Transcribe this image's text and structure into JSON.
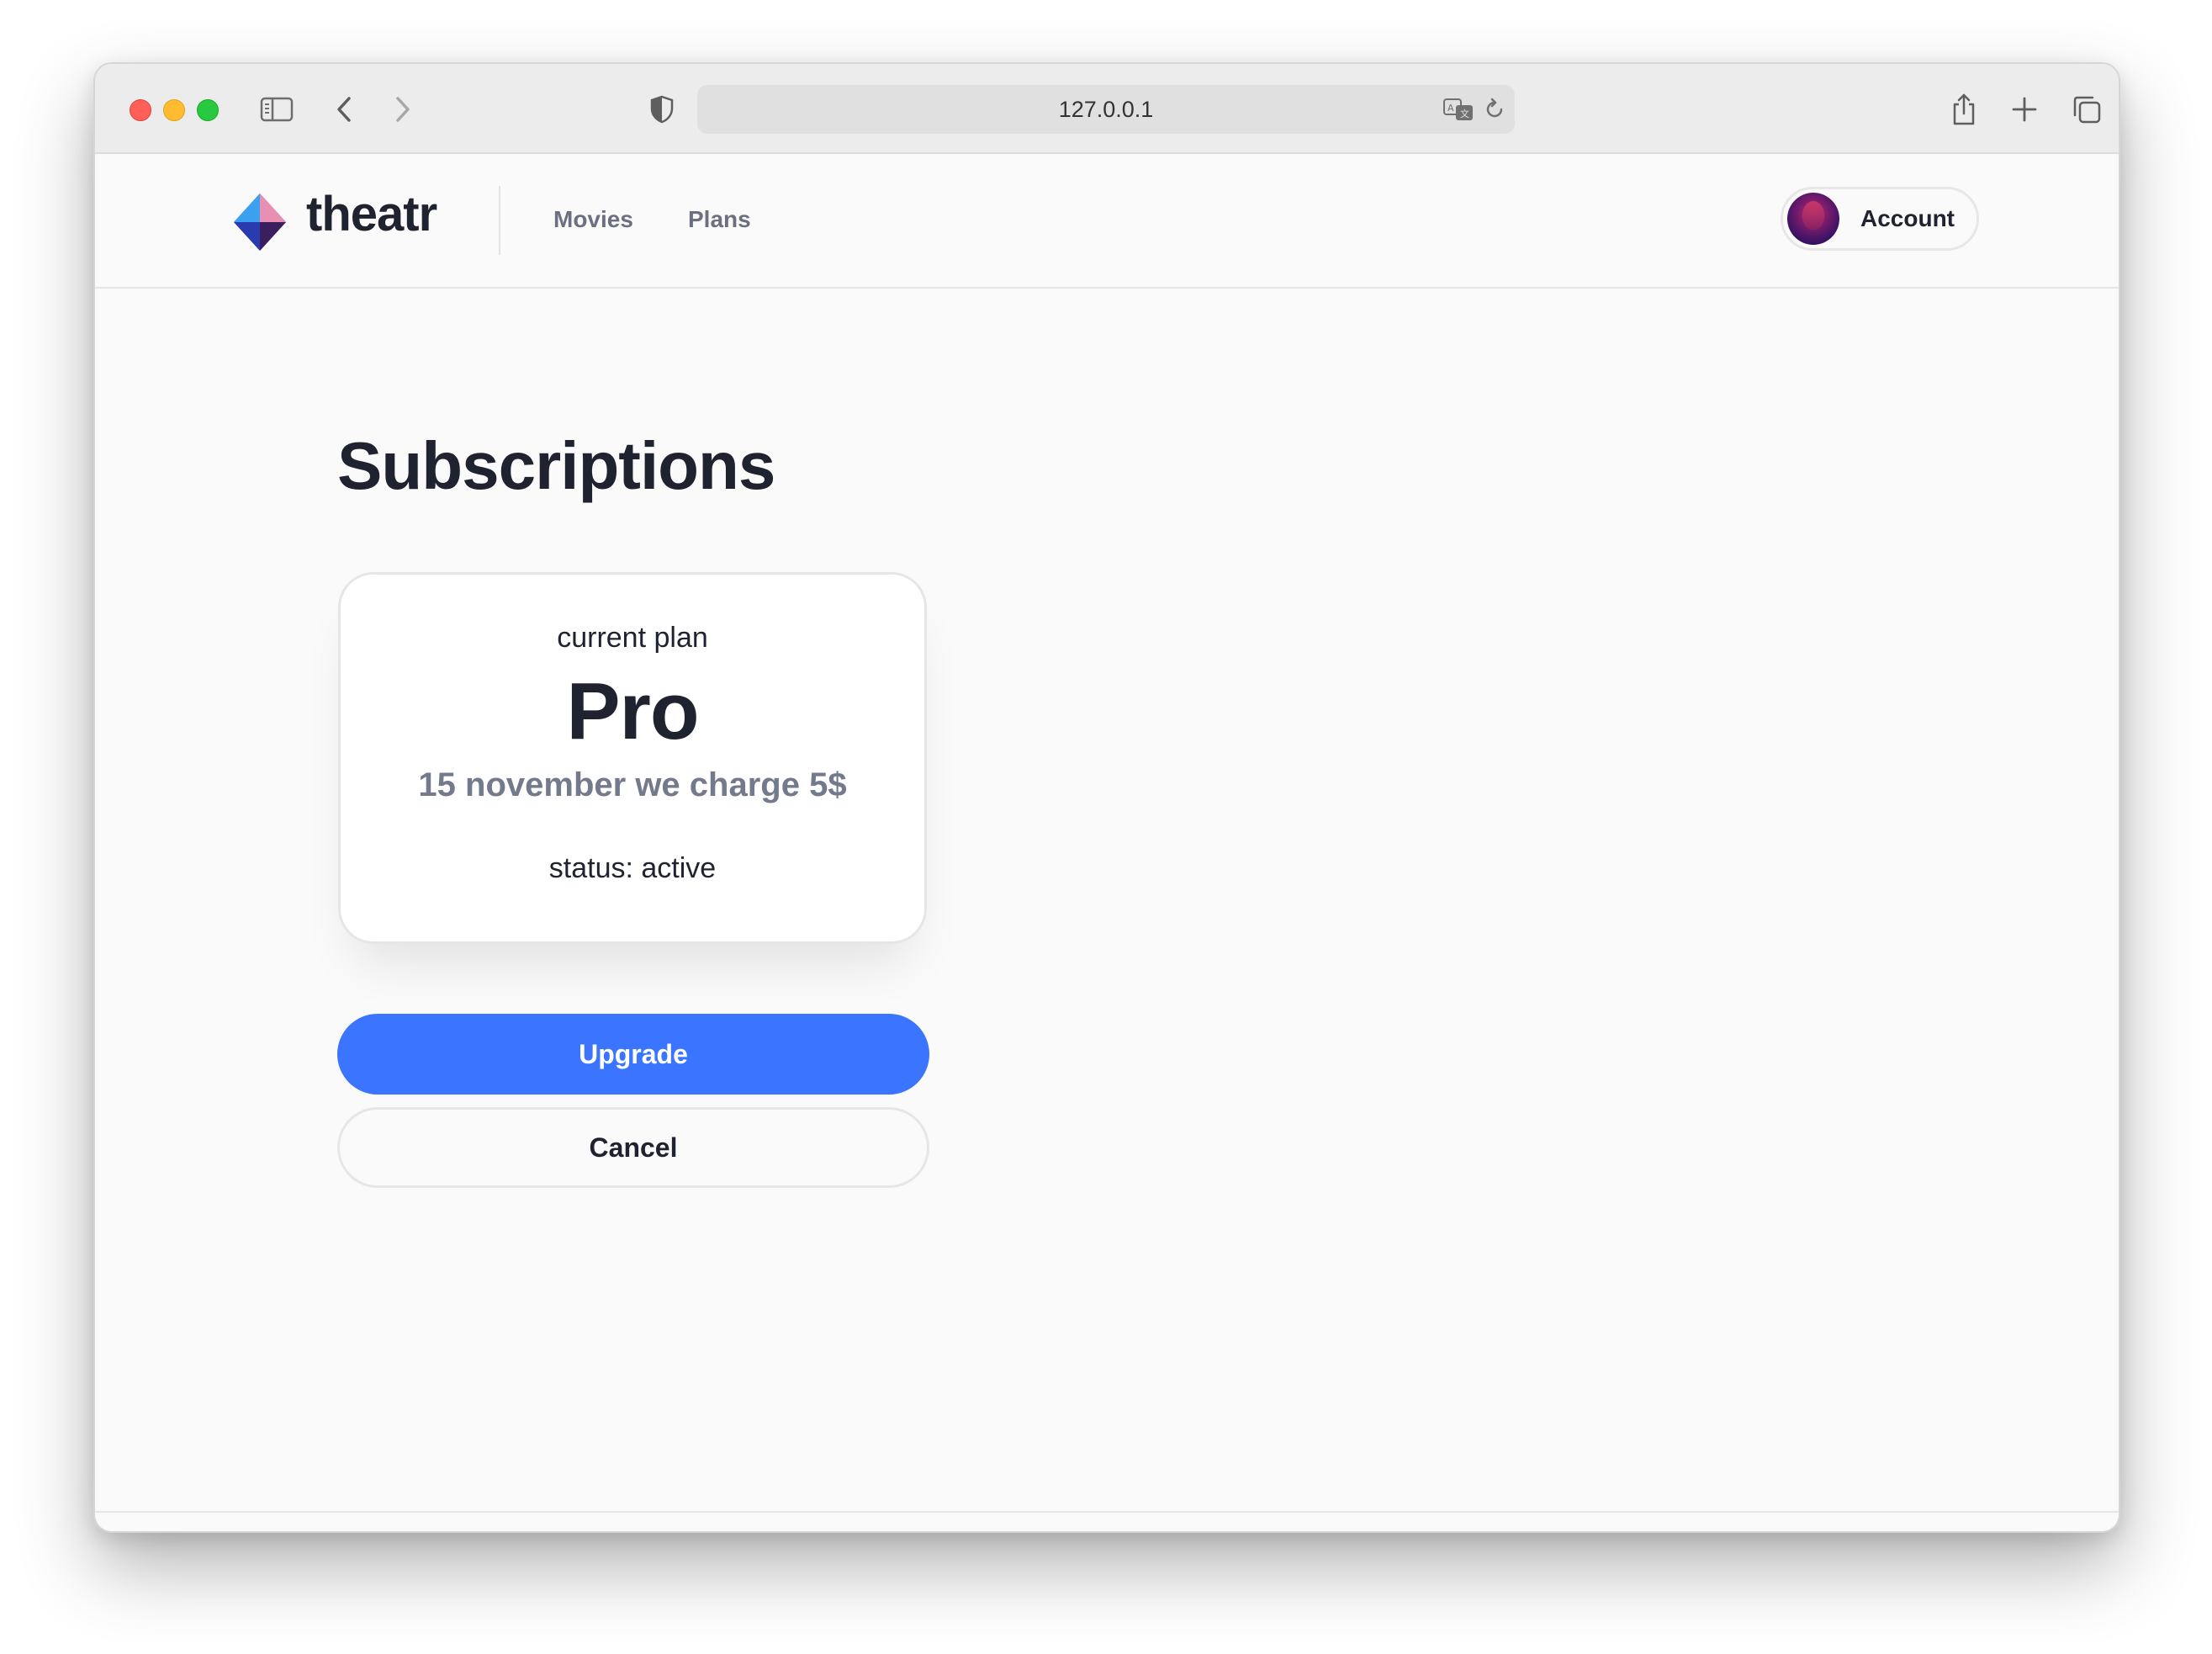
{
  "browser": {
    "url": "127.0.0.1"
  },
  "header": {
    "brand": "theatr",
    "nav": {
      "movies": "Movies",
      "plans": "Plans"
    },
    "account_label": "Account"
  },
  "main": {
    "title": "Subscriptions",
    "plan_card": {
      "caption": "current plan",
      "plan_name": "Pro",
      "charge_text": "15 november we charge 5$",
      "status_text": "status: active"
    },
    "buttons": {
      "upgrade": "Upgrade",
      "cancel": "Cancel"
    }
  },
  "colors": {
    "primary_button": "#3a74ff",
    "text_dark": "#1f2330",
    "text_muted": "#737a8c",
    "traffic_red": "#fe5f57",
    "traffic_yellow": "#febc2e",
    "traffic_green": "#28c840"
  },
  "icons": [
    "sidebar-icon",
    "back-chevron-icon",
    "forward-chevron-icon",
    "shield-icon",
    "translate-icon",
    "reload-icon",
    "share-icon",
    "new-tab-plus-icon",
    "tabs-overview-icon",
    "theatr-logo-icon"
  ]
}
